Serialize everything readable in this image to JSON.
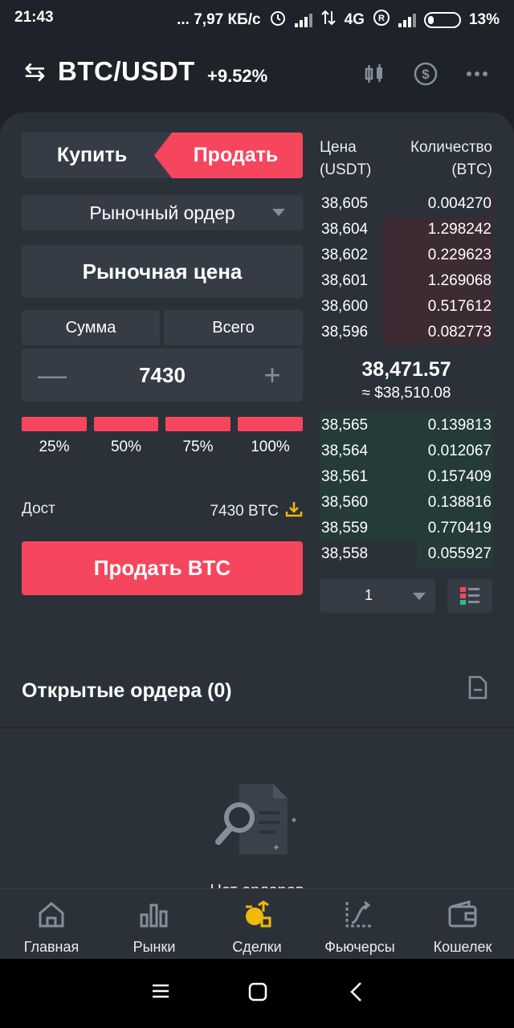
{
  "status_bar": {
    "time": "21:43",
    "network_speed": "... 7,97 КБ/с",
    "network_type": "4G",
    "battery": "13%"
  },
  "header": {
    "pair": "BTC/USDT",
    "change": "+9.52%",
    "icons": [
      "swap-icon",
      "candlestick-chart-icon",
      "dollar-icon",
      "more-icon"
    ]
  },
  "trade": {
    "buy_tab": "Купить",
    "sell_tab": "Продать",
    "order_type": "Рыночный ордер",
    "market_price": "Рыночная цена",
    "segment_amount": "Сумма",
    "segment_total": "Всего",
    "amount_value": "7430",
    "percentages": [
      "25%",
      "50%",
      "75%",
      "100%"
    ],
    "available_label": "Дост",
    "available_value": "7430 BTC",
    "sell_button": "Продать BTC"
  },
  "order_book": {
    "price_header_line1": "Цена",
    "price_header_line2": "(USDT)",
    "qty_header_line1": "Количество",
    "qty_header_line2": "(BTC)",
    "asks": [
      {
        "price": "38,605",
        "qty": "0.004270",
        "depth": 0.02
      },
      {
        "price": "38,604",
        "qty": "1.298242",
        "depth": 0.64
      },
      {
        "price": "38,602",
        "qty": "0.229623",
        "depth": 0.64
      },
      {
        "price": "38,601",
        "qty": "1.269068",
        "depth": 0.64
      },
      {
        "price": "38,600",
        "qty": "0.517612",
        "depth": 0.64
      },
      {
        "price": "38,596",
        "qty": "0.082773",
        "depth": 0.64
      }
    ],
    "last_price": "38,471.57",
    "last_price_usd": "≈ $38,510.08",
    "bids": [
      {
        "price": "38,565",
        "qty": "0.139813",
        "depth": 1.0
      },
      {
        "price": "38,564",
        "qty": "0.012067",
        "depth": 1.0
      },
      {
        "price": "38,561",
        "qty": "0.157409",
        "depth": 1.0
      },
      {
        "price": "38,560",
        "qty": "0.138816",
        "depth": 1.0
      },
      {
        "price": "38,559",
        "qty": "0.770419",
        "depth": 1.0
      },
      {
        "price": "38,558",
        "qty": "0.055927",
        "depth": 0.44
      }
    ],
    "depth_value": "1"
  },
  "open_orders": {
    "title": "Открытые ордера (0)",
    "empty_text": "Нет ордеров"
  },
  "bottom_nav": [
    {
      "label": "Главная",
      "icon": "home-icon"
    },
    {
      "label": "Рынки",
      "icon": "markets-icon"
    },
    {
      "label": "Сделки",
      "icon": "trades-icon"
    },
    {
      "label": "Фьючерсы",
      "icon": "futures-icon"
    },
    {
      "label": "Кошелек",
      "icon": "wallet-icon"
    }
  ],
  "colors": {
    "background": "#1e2329",
    "card": "#2b3139",
    "sell": "#f6465d",
    "ask_depth": "#3d2b33",
    "bid_depth": "#243b38",
    "accent": "#f0b90b"
  }
}
